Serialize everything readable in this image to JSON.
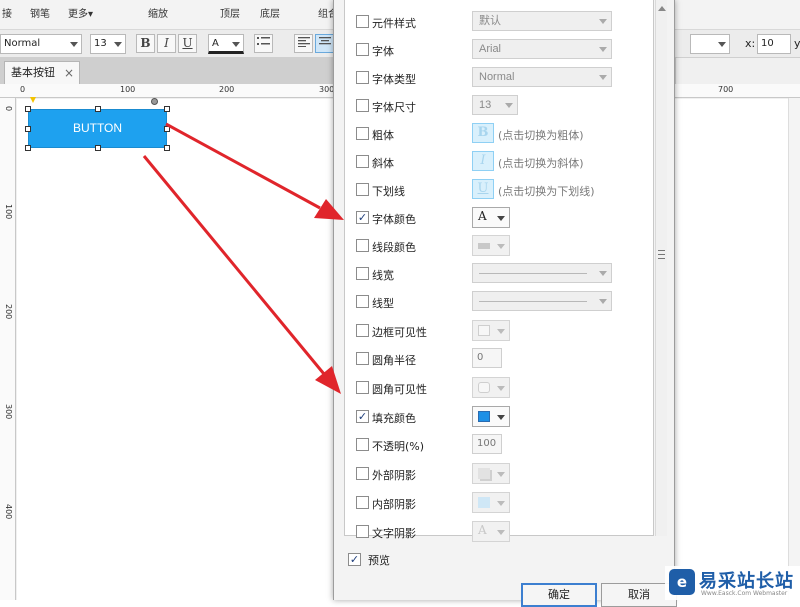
{
  "toolbar": {
    "items": [
      "接",
      "钢笔",
      "更多▾",
      "缩放",
      "顶层",
      "底层",
      "组合"
    ]
  },
  "format_bar": {
    "font_style": "Normal",
    "font_size": "13",
    "bold": "B",
    "italic": "I",
    "underline": "U",
    "font_color": "A",
    "x_label": "x:",
    "x_value": "10",
    "y_label": "y"
  },
  "tabs": {
    "active": "基本按钮",
    "close": "×"
  },
  "ruler": {
    "top": [
      "0",
      "100",
      "200",
      "300",
      "700"
    ],
    "left": [
      "0",
      "100",
      "200",
      "300",
      "400"
    ]
  },
  "widget": {
    "label": "BUTTON",
    "fill_color": "#1ea1ef"
  },
  "dialog": {
    "rows": [
      {
        "label": "元件样式",
        "checked": false,
        "value": "默认"
      },
      {
        "label": "字体",
        "checked": false,
        "value": "Arial"
      },
      {
        "label": "字体类型",
        "checked": false,
        "value": "Normal"
      },
      {
        "label": "字体尺寸",
        "checked": false,
        "value": "13"
      },
      {
        "label": "粗体",
        "checked": false,
        "button": "B",
        "hint": "(点击切换为粗体)"
      },
      {
        "label": "斜体",
        "checked": false,
        "button": "I",
        "hint": "(点击切换为斜体)"
      },
      {
        "label": "下划线",
        "checked": false,
        "button": "U",
        "hint": "(点击切换为下划线)"
      },
      {
        "label": "字体颜色",
        "checked": true,
        "glyph": "A"
      },
      {
        "label": "线段颜色",
        "checked": false
      },
      {
        "label": "线宽",
        "checked": false
      },
      {
        "label": "线型",
        "checked": false
      },
      {
        "label": "边框可见性",
        "checked": false
      },
      {
        "label": "圆角半径",
        "checked": false,
        "value": "0"
      },
      {
        "label": "圆角可见性",
        "checked": false
      },
      {
        "label": "填充颜色",
        "checked": true,
        "swatch": "#1e90e6"
      },
      {
        "label": "不透明(%)",
        "checked": false,
        "value": "100"
      },
      {
        "label": "外部阴影",
        "checked": false
      },
      {
        "label": "内部阴影",
        "checked": false
      },
      {
        "label": "文字阴影",
        "checked": false,
        "glyph": "A"
      }
    ],
    "check_mark": "✓",
    "preview": {
      "label": "预览",
      "checked": true
    },
    "ok_label": "确定",
    "cancel_label": "取消"
  },
  "watermark": {
    "logo": "e",
    "text": "易采站长站",
    "sub": "Www.Easck.Com Webmaster"
  },
  "colors": {
    "annotation_red": "#e0252b",
    "accent_blue": "#1ea1ef"
  }
}
